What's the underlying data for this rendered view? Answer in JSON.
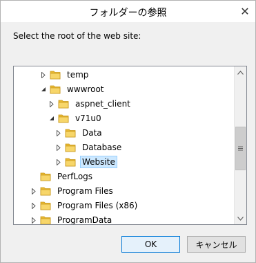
{
  "dialog": {
    "title": "フォルダーの参照",
    "close_glyph": "✕",
    "prompt": "Select the root of the web site:"
  },
  "tree": {
    "items": [
      {
        "label": "temp",
        "expander": "collapsed",
        "level": 2,
        "selected": false
      },
      {
        "label": "wwwroot",
        "expander": "expanded",
        "level": 2,
        "selected": false
      },
      {
        "label": "aspnet_client",
        "expander": "collapsed",
        "level": 3,
        "selected": false
      },
      {
        "label": "v71u0",
        "expander": "expanded",
        "level": 3,
        "selected": false
      },
      {
        "label": "Data",
        "expander": "collapsed",
        "level": 4,
        "selected": false
      },
      {
        "label": "Database",
        "expander": "collapsed",
        "level": 4,
        "selected": false
      },
      {
        "label": "Website",
        "expander": "collapsed",
        "level": 4,
        "selected": true
      },
      {
        "label": "PerfLogs",
        "expander": "none",
        "level": 1,
        "selected": false
      },
      {
        "label": "Program Files",
        "expander": "collapsed",
        "level": 1,
        "selected": false
      },
      {
        "label": "Program Files (x86)",
        "expander": "collapsed",
        "level": 1,
        "selected": false
      },
      {
        "label": "ProgramData",
        "expander": "collapsed",
        "level": 1,
        "selected": false
      }
    ]
  },
  "buttons": {
    "ok": "OK",
    "cancel": "キャンセル"
  },
  "colors": {
    "folder": "#e8b830",
    "selection_bg": "#cce8ff",
    "default_button_border": "#0078d7"
  }
}
